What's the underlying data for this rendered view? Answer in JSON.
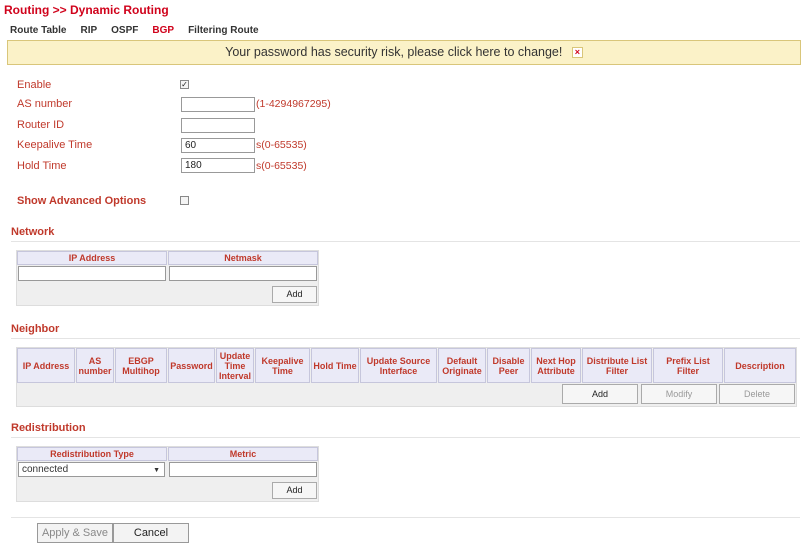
{
  "breadcrumb": "Routing >> Dynamic Routing",
  "tabs": [
    "Route Table",
    "RIP",
    "OSPF",
    "BGP",
    "Filtering Route"
  ],
  "warning": {
    "text": "Your password has security risk, please click here to change!",
    "close": "×"
  },
  "form": {
    "enable_label": "Enable",
    "as_label": "AS number",
    "as_value": "",
    "as_hint": "(1-4294967295)",
    "router_id_label": "Router ID",
    "router_id_value": "",
    "keepalive_label": "Keepalive Time",
    "keepalive_value": "60",
    "keepalive_hint": "s(0-65535)",
    "hold_label": "Hold Time",
    "hold_value": "180",
    "hold_hint": "s(0-65535)",
    "advanced_label": "Show Advanced Options"
  },
  "network": {
    "title": "Network",
    "headers": [
      "IP Address",
      "Netmask"
    ],
    "add": "Add"
  },
  "neighbor": {
    "title": "Neighbor",
    "headers": [
      "IP Address",
      "AS number",
      "EBGP Multihop",
      "Password",
      "Update Time Interval",
      "Keepalive Time",
      "Hold Time",
      "Update Source Interface",
      "Default Originate",
      "Disable Peer",
      "Next Hop Attribute",
      "Distribute List Filter",
      "Prefix List Filter",
      "Description"
    ],
    "add": "Add",
    "modify": "Modify",
    "delete": "Delete"
  },
  "redistribution": {
    "title": "Redistribution",
    "headers": [
      "Redistribution Type",
      "Metric"
    ],
    "type_value": "connected",
    "add": "Add"
  },
  "footer": {
    "apply": "Apply & Save",
    "cancel": "Cancel"
  },
  "colors": {
    "accent": "#d0021b",
    "warning_bg": "#fbf2c8",
    "header_bg": "#eaeaf7"
  }
}
